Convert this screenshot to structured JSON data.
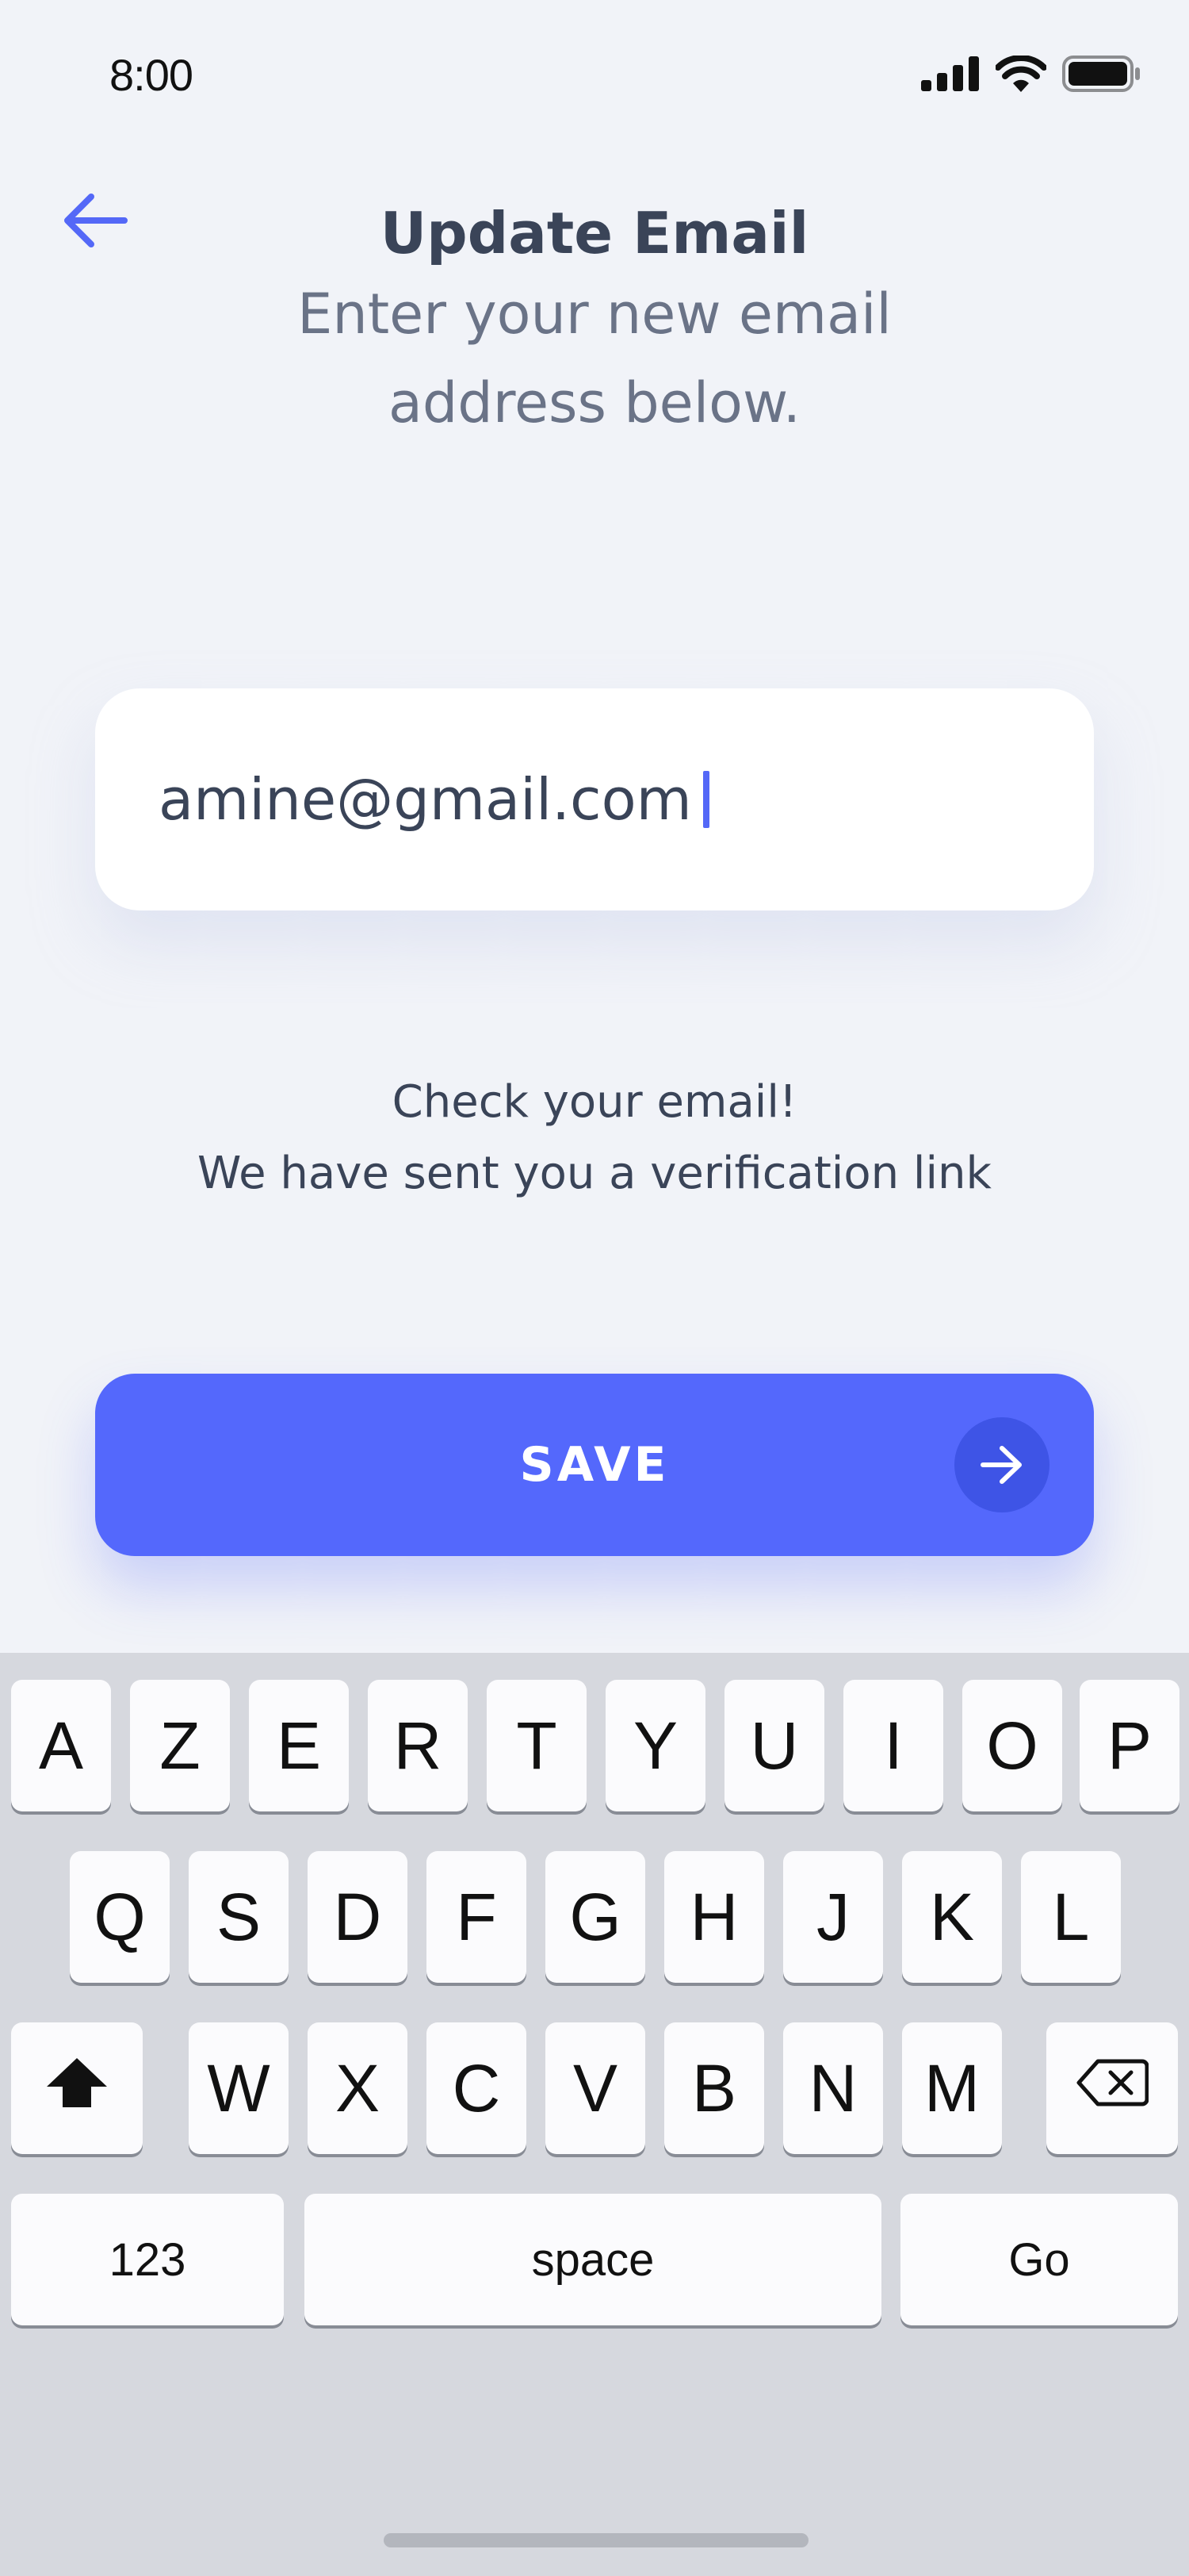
{
  "status_bar": {
    "time": "8:00",
    "icons": [
      "cellular-signal-icon",
      "wifi-icon",
      "battery-icon"
    ]
  },
  "header": {
    "back_icon": "arrow-left-icon",
    "title": "Update Email",
    "subtitle": "Enter your new email address below."
  },
  "form": {
    "email_value": "amine@gmail.com"
  },
  "notice": {
    "line1": "Check your email!",
    "line2": "We have sent you a verification link"
  },
  "save_button": {
    "label": "SAVE",
    "icon": "arrow-right-icon"
  },
  "keyboard": {
    "row1": [
      "A",
      "Z",
      "E",
      "R",
      "T",
      "Y",
      "U",
      "I",
      "O",
      "P"
    ],
    "row2": [
      "Q",
      "S",
      "D",
      "F",
      "G",
      "H",
      "J",
      "K",
      "L"
    ],
    "row3": [
      "W",
      "X",
      "C",
      "V",
      "B",
      "N",
      "M"
    ],
    "shift_icon": "shift-icon",
    "delete_icon": "backspace-icon",
    "numbers_label": "123",
    "space_label": "space",
    "go_label": "Go"
  },
  "colors": {
    "accent": "#5468fc",
    "background": "#f1f3f8",
    "keyboard_bg": "#d6d8de"
  }
}
